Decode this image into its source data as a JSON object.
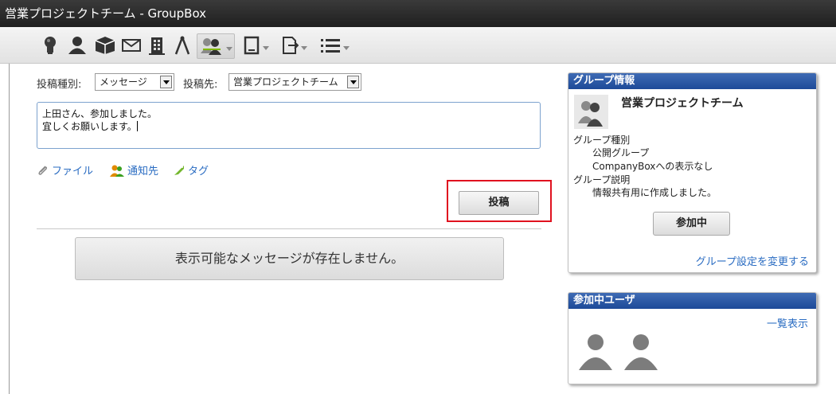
{
  "window": {
    "title": "営業プロジェクトチーム - GroupBox"
  },
  "toolbar": {
    "icons": [
      "lightbulb-icon",
      "user-icon",
      "box-icon",
      "mail-icon",
      "building-icon",
      "tools-icon",
      "group-icon",
      "device-icon",
      "export-icon",
      "list-icon"
    ],
    "selected": "group-icon"
  },
  "post_form": {
    "type_label": "投稿種別:",
    "type_value": "メッセージ",
    "dest_label": "投稿先:",
    "dest_value": "営業プロジェクトチーム",
    "message_line1": "上田さん、参加しました。",
    "message_line2": "宜しくお願いします。",
    "file_label": "ファイル",
    "notify_label": "通知先",
    "tag_label": "タグ",
    "post_button": "投稿"
  },
  "feed": {
    "empty_message": "表示可能なメッセージが存在しません。"
  },
  "group_info": {
    "header": "グループ情報",
    "name": "営業プロジェクトチーム",
    "type_label": "グループ種別",
    "type_value": "公開グループ",
    "companybox_value": "CompanyBoxへの表示なし",
    "desc_label": "グループ説明",
    "desc_value": "情報共有用に作成しました。",
    "join_button": "参加中",
    "settings_link": "グループ設定を変更する"
  },
  "members": {
    "header": "参加中ユーザ",
    "list_link": "一覧表示"
  },
  "colors": {
    "accent_blue": "#1d4a98",
    "link": "#2a6cc2",
    "highlight": "#e0121f"
  }
}
